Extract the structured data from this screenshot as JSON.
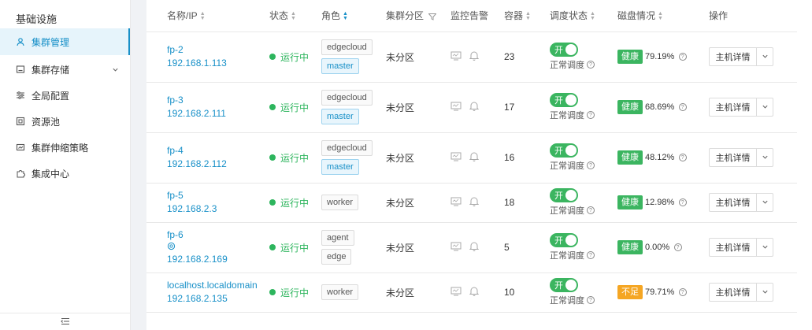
{
  "sidebar": {
    "title": "基础设施",
    "items": [
      {
        "label": "集群管理",
        "icon": "cluster-icon",
        "active": true
      },
      {
        "label": "集群存储",
        "icon": "storage-icon",
        "has_children": true
      },
      {
        "label": "全局配置",
        "icon": "sliders-icon"
      },
      {
        "label": "资源池",
        "icon": "pool-icon"
      },
      {
        "label": "集群伸缩策略",
        "icon": "scale-icon"
      },
      {
        "label": "集成中心",
        "icon": "puzzle-icon"
      }
    ]
  },
  "table": {
    "headers": {
      "name": "名称/IP",
      "status": "状态",
      "role": "角色",
      "zone": "集群分区",
      "monitor": "监控告警",
      "container": "容器",
      "schedule": "调度状态",
      "disk": "磁盘情况",
      "action": "操作"
    },
    "rows": [
      {
        "name": "fp-2",
        "ip": "192.168.1.113",
        "status": "运行中",
        "roles": [
          "edgecloud",
          "master"
        ],
        "zone": "未分区",
        "containers": "23",
        "toggle": "开",
        "schedule": "正常调度",
        "disk_state": "健康",
        "disk_pct": "79.19%",
        "action": "主机详情"
      },
      {
        "name": "fp-3",
        "ip": "192.168.2.111",
        "status": "运行中",
        "roles": [
          "edgecloud",
          "master"
        ],
        "zone": "未分区",
        "containers": "17",
        "toggle": "开",
        "schedule": "正常调度",
        "disk_state": "健康",
        "disk_pct": "68.69%",
        "action": "主机详情"
      },
      {
        "name": "fp-4",
        "ip": "192.168.2.112",
        "status": "运行中",
        "roles": [
          "edgecloud",
          "master"
        ],
        "zone": "未分区",
        "containers": "16",
        "toggle": "开",
        "schedule": "正常调度",
        "disk_state": "健康",
        "disk_pct": "48.12%",
        "action": "主机详情"
      },
      {
        "name": "fp-5",
        "ip": "192.168.2.3",
        "status": "运行中",
        "roles": [
          "worker"
        ],
        "zone": "未分区",
        "containers": "18",
        "toggle": "开",
        "schedule": "正常调度",
        "disk_state": "健康",
        "disk_pct": "12.98%",
        "action": "主机详情"
      },
      {
        "name": "fp-6",
        "ip": "192.168.2.169",
        "status": "运行中",
        "roles": [
          "agent",
          "edge"
        ],
        "zone": "未分区",
        "containers": "5",
        "toggle": "开",
        "schedule": "正常调度",
        "disk_state": "健康",
        "disk_pct": "0.00%",
        "action": "主机详情",
        "has_edge_icon": true
      },
      {
        "name": "localhost.localdomain",
        "ip": "192.168.2.135",
        "status": "运行中",
        "roles": [
          "worker"
        ],
        "zone": "未分区",
        "containers": "10",
        "toggle": "开",
        "schedule": "正常调度",
        "disk_state": "不足",
        "disk_pct": "79.71%",
        "action": "主机详情",
        "disk_warn": true
      }
    ]
  }
}
